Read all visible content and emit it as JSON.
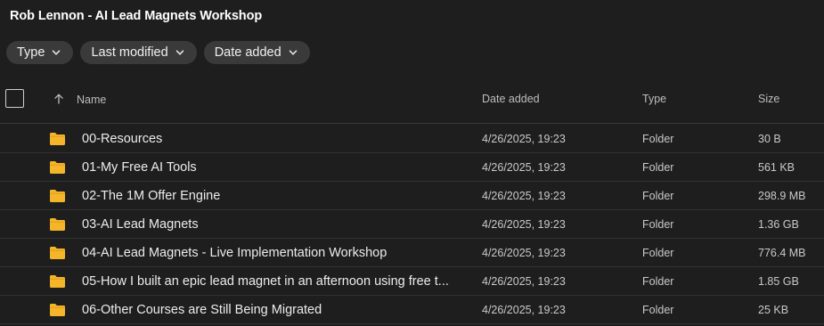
{
  "title": "Rob Lennon - AI Lead Magnets Workshop",
  "filters": [
    {
      "label": "Type"
    },
    {
      "label": "Last modified"
    },
    {
      "label": "Date added"
    }
  ],
  "columns": {
    "name": "Name",
    "date_added": "Date added",
    "type": "Type",
    "size": "Size"
  },
  "rows": [
    {
      "name": "00-Resources",
      "date": "4/26/2025, 19:23",
      "type": "Folder",
      "size": "30 B"
    },
    {
      "name": "01-My Free AI Tools",
      "date": "4/26/2025, 19:23",
      "type": "Folder",
      "size": "561 KB"
    },
    {
      "name": "02-The 1M Offer Engine",
      "date": "4/26/2025, 19:23",
      "type": "Folder",
      "size": "298.9 MB"
    },
    {
      "name": "03-AI Lead Magnets",
      "date": "4/26/2025, 19:23",
      "type": "Folder",
      "size": "1.36 GB"
    },
    {
      "name": "04-AI Lead Magnets - Live Implementation Workshop",
      "date": "4/26/2025, 19:23",
      "type": "Folder",
      "size": "776.4 MB"
    },
    {
      "name": "05-How I built an epic lead magnet in an afternoon using free t...",
      "date": "4/26/2025, 19:23",
      "type": "Folder",
      "size": "1.85 GB"
    },
    {
      "name": "06-Other Courses are Still Being Migrated",
      "date": "4/26/2025, 19:23",
      "type": "Folder",
      "size": "25 KB"
    }
  ],
  "colors": {
    "background": "#1e1e1e",
    "chip": "#3a3a3a",
    "folder": "#f5b52a"
  },
  "icons": {
    "sort": "arrow-up-icon",
    "filter_chevron": "chevron-down-icon",
    "row": "folder-icon"
  }
}
